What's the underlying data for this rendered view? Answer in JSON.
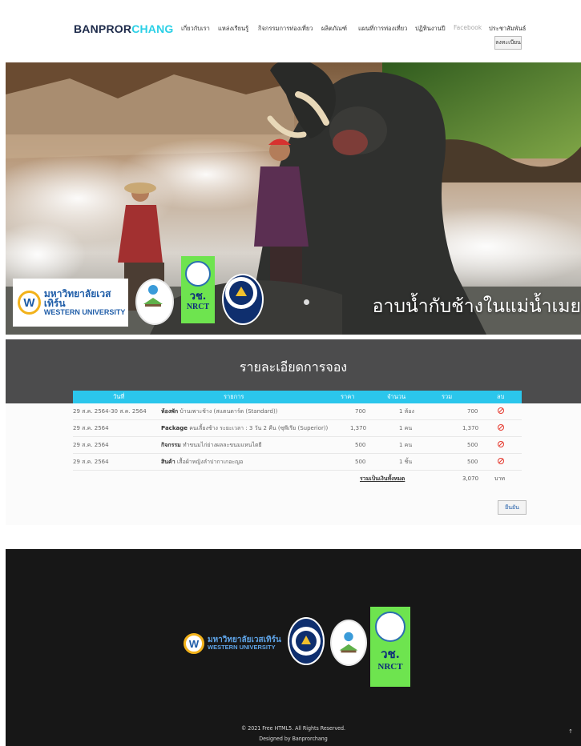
{
  "header": {
    "logo_part1": "BANPROR",
    "logo_part2": "CHANG",
    "nav": [
      {
        "label": "เกี่ยวกับเรา"
      },
      {
        "label": "แหล่งเรียนรู้"
      },
      {
        "label": "กิจกรรมการท่องเที่ยว"
      },
      {
        "label": "ผลิตภัณฑ์"
      },
      {
        "label": "แผนที่การท่องเที่ยว"
      },
      {
        "label": "ปฏิทินงานปี"
      },
      {
        "label": "Facebook"
      },
      {
        "label": "ประชาสัมพันธ์"
      }
    ],
    "login_label": "ลงทะเบียน"
  },
  "hero": {
    "caption": "อาบน้ำกับช้างในแม่น้ำเมย",
    "logos": {
      "wu_th": "มหาวิทยาลัยเวสเทิร์น",
      "wu_en": "WESTERN UNIVERSITY",
      "nrct_th": "วช.",
      "nrct_en": "NRCT"
    }
  },
  "booking": {
    "title": "รายละเอียดการจอง",
    "columns": [
      "วันที่",
      "รายการ",
      "ราคา",
      "จำนวน",
      "รวม",
      "ลบ"
    ],
    "rows": [
      {
        "date": "29 ส.ค. 2564-30 ส.ค. 2564",
        "category": "ห้องพัก",
        "item": "บ้านเพาะช้าง (สแตนดาร์ด (Standard))",
        "price": "700",
        "qty": "1 ห้อง",
        "total": "700"
      },
      {
        "date": "29 ส.ค. 2564",
        "category": "Package",
        "item": "คนเลี้ยงช้าง ระยะเวลา : 3 วัน 2 คืน (ซุพีเรีย (Superior))",
        "price": "1,370",
        "qty": "1 คน",
        "total": "1,370"
      },
      {
        "date": "29 ส.ค. 2564",
        "category": "กิจกรรม",
        "item": "ทำขนมไก่ย่างผลละขนมแหนไตยี",
        "price": "500",
        "qty": "1 คน",
        "total": "500"
      },
      {
        "date": "29 ส.ค. 2564",
        "category": "สินค้า",
        "item": "เสื้อผ้าหญิงลำปากาเกอะญอ",
        "price": "500",
        "qty": "1 ชิ้น",
        "total": "500"
      }
    ],
    "total_label": "รวมเป็นเงินทั้งหมด",
    "grand_total": "3,070",
    "currency": "บาท",
    "confirm_label": "ยืนยัน"
  },
  "footer": {
    "copyright": "© 2021 Free HTML5. All Rights Reserved.",
    "designed_by": "Designed by Banprorchang",
    "back_to_top": "↑"
  },
  "colors": {
    "accent": "#2bc6ec",
    "logo_dark": "#1d2a4a",
    "logo_light": "#2bd0e6",
    "delete": "#e53a2f",
    "booking_header": "#4c4c4d",
    "footer": "#171717"
  }
}
